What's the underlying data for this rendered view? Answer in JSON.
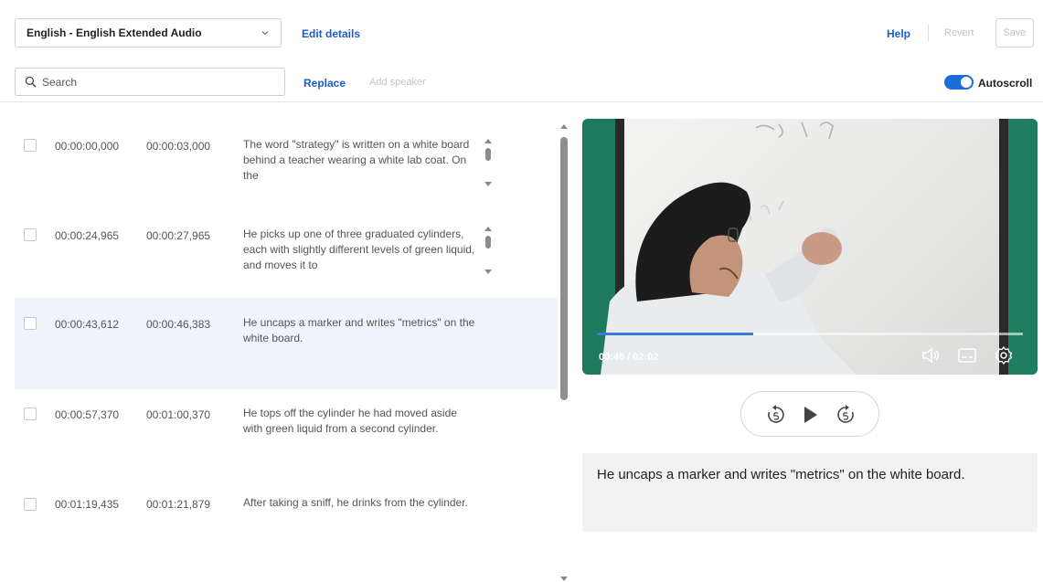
{
  "toolbar": {
    "language": "English - English Extended Audio",
    "edit_details": "Edit details",
    "help": "Help",
    "revert": "Revert",
    "save": "Save"
  },
  "search": {
    "placeholder": "Search",
    "replace": "Replace",
    "add_speaker": "Add speaker"
  },
  "autoscroll": {
    "label": "Autoscroll",
    "enabled": true
  },
  "captions": [
    {
      "start": "00:00:00,000",
      "end": "00:00:03,000",
      "text": "The word \"strategy\" is written on a white board behind a teacher wearing a white lab coat. On the",
      "selected": false
    },
    {
      "start": "00:00:24,965",
      "end": "00:00:27,965",
      "text": "He picks up one of three graduated cylinders, each with slightly different levels of green liquid, and moves it to",
      "selected": false
    },
    {
      "start": "00:00:43,612",
      "end": "00:00:46,383",
      "text": "He uncaps a marker and writes \"metrics\" on the white board.",
      "selected": true
    },
    {
      "start": "00:00:57,370",
      "end": "00:01:00,370",
      "text": "He tops off the cylinder he had moved aside with green liquid from a second cylinder.",
      "selected": false
    },
    {
      "start": "00:01:19,435",
      "end": "00:01:21,879",
      "text": "After taking a sniff, he drinks from the cylinder.",
      "selected": false
    }
  ],
  "player": {
    "timecode": "00:45 / 02:02",
    "progress_fraction": 0.368,
    "controls": [
      "volume-icon",
      "captions-icon",
      "settings-icon"
    ],
    "transport": [
      "rewind-5-icon",
      "play-icon",
      "forward-5-icon"
    ],
    "accent": "#3d7bd9"
  },
  "current_caption": "He uncaps a marker and writes \"metrics\" on the white board.",
  "colors": {
    "link": "#1a5ccc",
    "toggle": "#1a6fd6",
    "selected_row": "#eef4fb"
  }
}
